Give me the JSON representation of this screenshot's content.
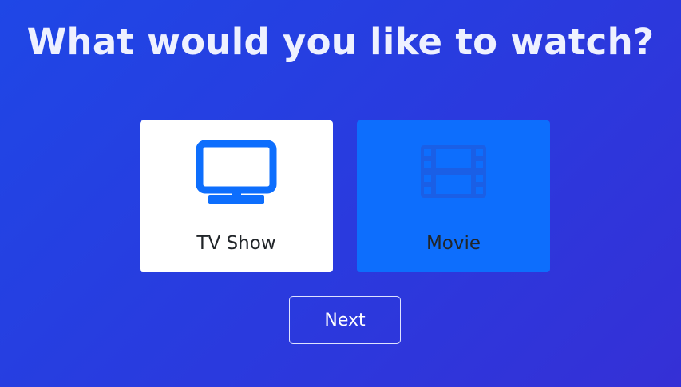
{
  "heading": "What would you like to watch?",
  "options": [
    {
      "label": "TV Show",
      "icon": "tv-icon",
      "selected": true
    },
    {
      "label": "Movie",
      "icon": "film-icon",
      "selected": false
    }
  ],
  "next_label": "Next",
  "colors": {
    "background_start": "#1f47e6",
    "background_end": "#3530d6",
    "selected_card": "#ffffff",
    "unselected_card": "#0d6efd",
    "icon_selected": "#0d6efd",
    "icon_unselected": "#1a5fe6",
    "label_text": "#212529",
    "heading_text": "#eef1ff"
  }
}
